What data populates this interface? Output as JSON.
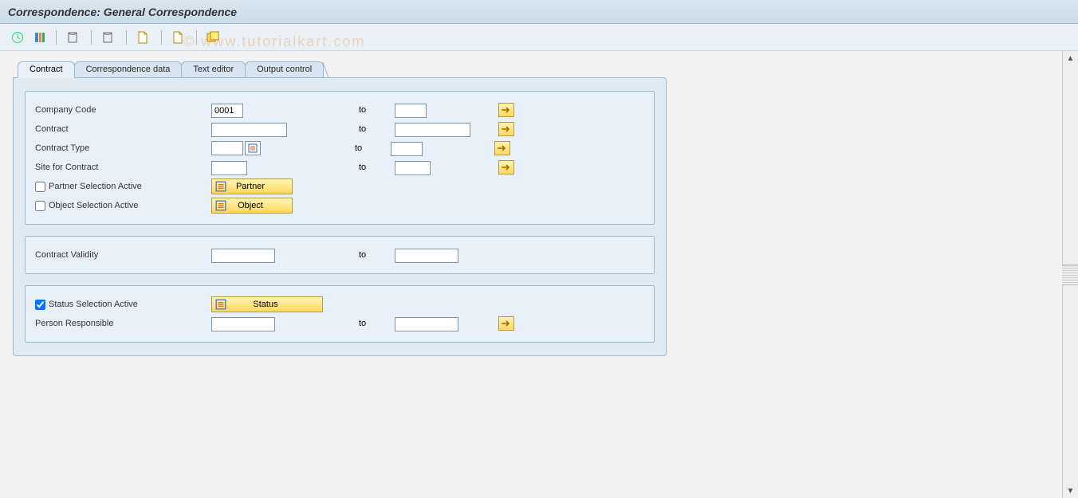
{
  "title": "Correspondence: General Correspondence",
  "watermark": "© www.tutorialkart.com",
  "toolbar": [
    {
      "icon": "execute"
    },
    {
      "icon": "variant"
    },
    {
      "sep": true
    },
    {
      "icon": "log",
      "label": "Last Log"
    },
    {
      "sep": true
    },
    {
      "icon": "log",
      "label": "Overview"
    },
    {
      "sep": true
    },
    {
      "icon": "doc",
      "label": "Last Document Creation"
    },
    {
      "sep": true
    },
    {
      "icon": "doc",
      "label": "Overview"
    },
    {
      "sep": true
    },
    {
      "icon": "sets",
      "label": "Selection via Sets"
    }
  ],
  "tabs": [
    "Contract",
    "Correspondence data",
    "Text editor",
    "Output control"
  ],
  "labels": {
    "company_code": "Company Code",
    "contract": "Contract",
    "contract_type": "Contract Type",
    "site": "Site for Contract",
    "partner_sel": "Partner Selection Active",
    "object_sel": "Object Selection Active",
    "contract_validity": "Contract Validity",
    "status_sel": "Status Selection Active",
    "person_resp": "Person Responsible",
    "to": "to"
  },
  "buttons": {
    "partner": "Partner",
    "object": "Object",
    "status": "Status"
  },
  "values": {
    "company_code_from": "0001",
    "company_code_to": "",
    "contract_from": "",
    "contract_to": "",
    "contract_type_from": "",
    "contract_type_to": "",
    "site_from": "",
    "site_to": "",
    "validity_from": "",
    "validity_to": "",
    "person_from": "",
    "person_to": ""
  },
  "checks": {
    "partner": false,
    "object": false,
    "status": true
  }
}
